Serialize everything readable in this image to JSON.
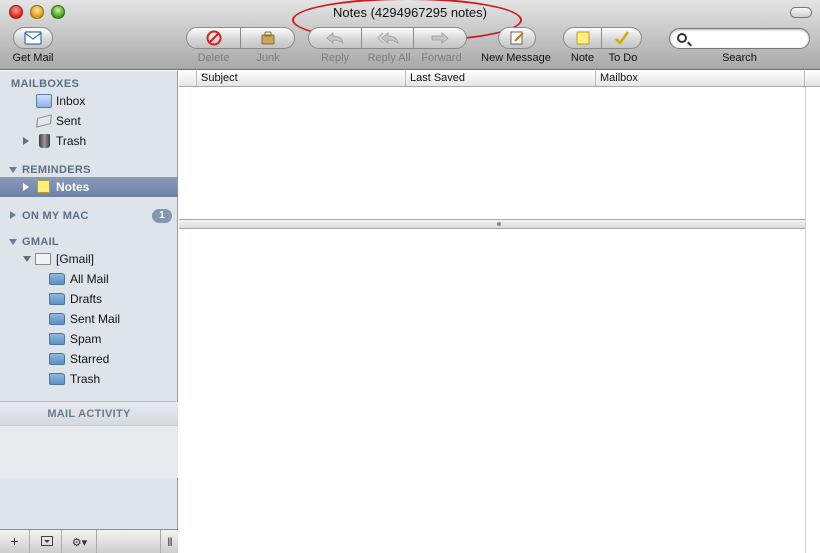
{
  "window": {
    "title": "Notes (4294967295 notes)"
  },
  "toolbar": {
    "get_mail": "Get Mail",
    "delete": "Delete",
    "junk": "Junk",
    "reply": "Reply",
    "reply_all": "Reply All",
    "forward": "Forward",
    "new_message": "New Message",
    "note": "Note",
    "todo": "To Do",
    "search_label": "Search",
    "search_value": ""
  },
  "sidebar": {
    "mailboxes": {
      "header": "MAILBOXES",
      "items": [
        {
          "label": "Inbox",
          "icon": "inbox-icon"
        },
        {
          "label": "Sent",
          "icon": "sent-icon"
        },
        {
          "label": "Trash",
          "icon": "trash-icon"
        }
      ]
    },
    "reminders": {
      "header": "REMINDERS",
      "items": [
        {
          "label": "Notes",
          "icon": "note-icon",
          "selected": true
        }
      ]
    },
    "on_my_mac": {
      "header": "ON MY MAC",
      "badge": "1"
    },
    "gmail": {
      "header": "GMAIL",
      "account": "[Gmail]",
      "folders": [
        {
          "label": "All Mail"
        },
        {
          "label": "Drafts"
        },
        {
          "label": "Sent Mail"
        },
        {
          "label": "Spam"
        },
        {
          "label": "Starred"
        },
        {
          "label": "Trash"
        }
      ]
    },
    "activity": {
      "header": "MAIL ACTIVITY"
    },
    "bottom": {
      "add": "+",
      "gear": "⚙▾"
    }
  },
  "message_list": {
    "columns": [
      "Subject",
      "Last Saved",
      "Mailbox"
    ]
  },
  "colors": {
    "sidebar_bg": "#dfe4ea",
    "selection": "#6d82a6",
    "section_text": "#5b6f84",
    "annotation": "#d01818"
  }
}
